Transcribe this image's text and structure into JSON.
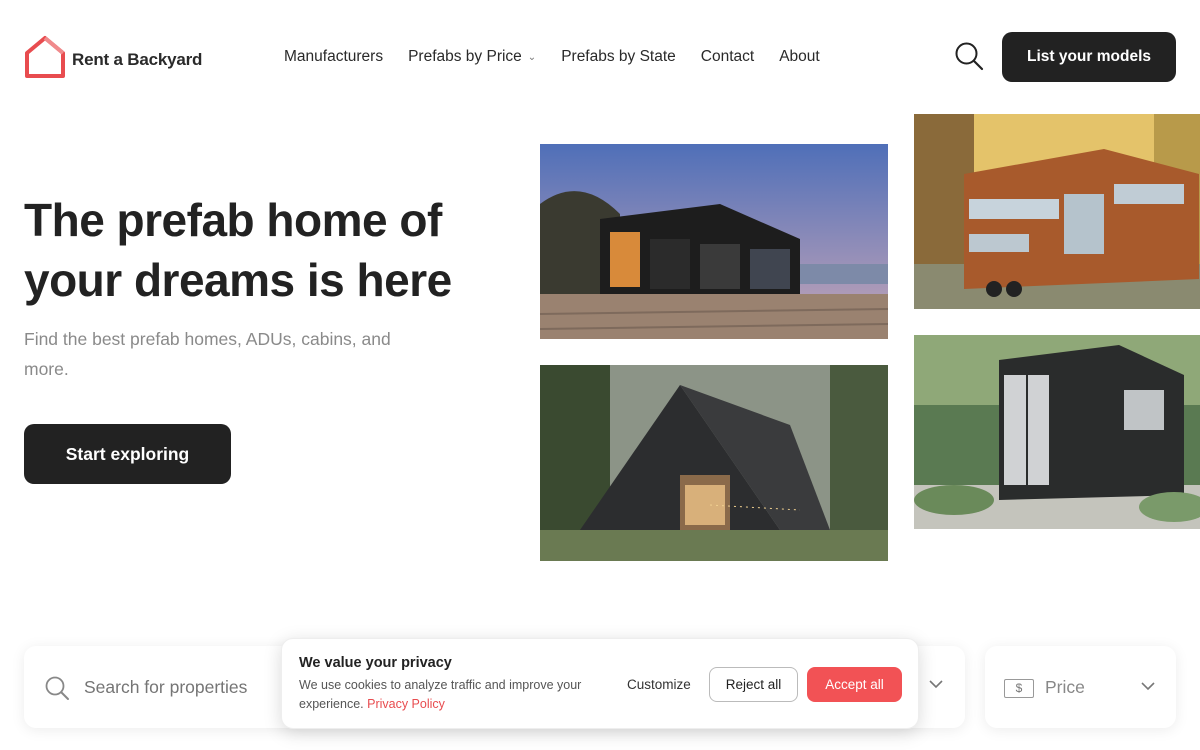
{
  "brand": {
    "name": "Rent a Backyard",
    "accent": "#e84c4f"
  },
  "nav": {
    "items": [
      {
        "label": "Manufacturers",
        "has_dropdown": false
      },
      {
        "label": "Prefabs by Price",
        "has_dropdown": true
      },
      {
        "label": "Prefabs by State",
        "has_dropdown": false
      },
      {
        "label": "Contact",
        "has_dropdown": false
      },
      {
        "label": "About",
        "has_dropdown": false
      }
    ],
    "search_icon": "search-icon",
    "cta_label": "List your models"
  },
  "hero": {
    "title_line1": "The prefab home of",
    "title_line2": "your dreams is here",
    "subtitle_line1": "Find the best prefab homes, ADUs, cabins, and",
    "subtitle_line2": "more.",
    "button_label": "Start exploring"
  },
  "gallery": {
    "images": [
      "modern-glass-house-photo",
      "tiny-house-on-wheels-photo",
      "a-frame-cabin-photo",
      "container-home-photo"
    ]
  },
  "search": {
    "placeholder": "Search for properties",
    "price_label": "Price",
    "price_icon": "dollar-bill-icon"
  },
  "cookie": {
    "title": "We value your privacy",
    "text": "We use cookies to analyze traffic and improve your experience.",
    "link": "Privacy Policy",
    "customize": "Customize",
    "reject": "Reject all",
    "accept": "Accept all",
    "accept_color": "#f25255"
  }
}
